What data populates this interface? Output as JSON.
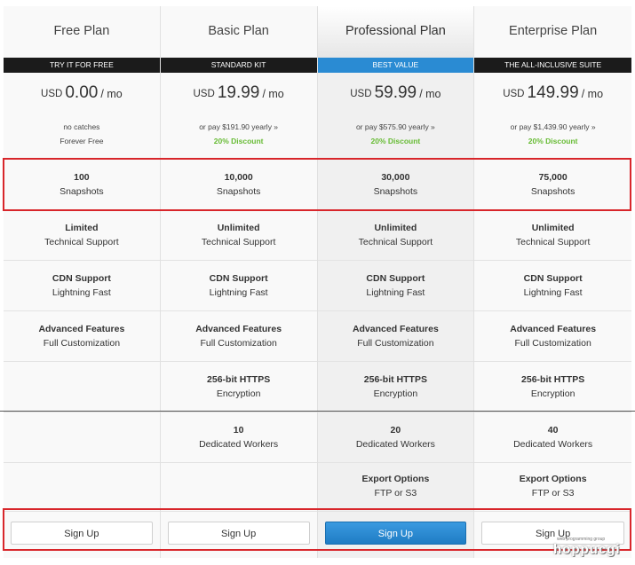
{
  "plans": [
    {
      "name": "Free Plan",
      "banner": "TRY IT FOR FREE",
      "currency": "USD",
      "price": "0.00",
      "per": "/ mo",
      "sub1": "no catches",
      "sub2": "Forever Free",
      "snapshots_value": "100",
      "snapshots_label": "Snapshots",
      "support_value": "Limited",
      "support_label": "Technical Support",
      "cdn_value": "CDN Support",
      "cdn_label": "Lightning Fast",
      "adv_value": "Advanced Features",
      "adv_label": "Full Customization",
      "https_value": "",
      "https_label": "",
      "workers_value": "",
      "workers_label": "",
      "export_value": "",
      "export_label": "",
      "button": "Sign Up"
    },
    {
      "name": "Basic Plan",
      "banner": "STANDARD KIT",
      "currency": "USD",
      "price": "19.99",
      "per": "/ mo",
      "sub1": "or pay $191.90 yearly »",
      "sub2": "20% Discount",
      "snapshots_value": "10,000",
      "snapshots_label": "Snapshots",
      "support_value": "Unlimited",
      "support_label": "Technical Support",
      "cdn_value": "CDN Support",
      "cdn_label": "Lightning Fast",
      "adv_value": "Advanced Features",
      "adv_label": "Full Customization",
      "https_value": "256-bit HTTPS",
      "https_label": "Encryption",
      "workers_value": "10",
      "workers_label": "Dedicated Workers",
      "export_value": "",
      "export_label": "",
      "button": "Sign Up"
    },
    {
      "name": "Professional Plan",
      "banner": "BEST VALUE",
      "currency": "USD",
      "price": "59.99",
      "per": "/ mo",
      "sub1": "or pay $575.90 yearly »",
      "sub2": "20% Discount",
      "snapshots_value": "30,000",
      "snapshots_label": "Snapshots",
      "support_value": "Unlimited",
      "support_label": "Technical Support",
      "cdn_value": "CDN Support",
      "cdn_label": "Lightning Fast",
      "adv_value": "Advanced Features",
      "adv_label": "Full Customization",
      "https_value": "256-bit HTTPS",
      "https_label": "Encryption",
      "workers_value": "20",
      "workers_label": "Dedicated Workers",
      "export_value": "Export Options",
      "export_label": "FTP or S3",
      "button": "Sign Up"
    },
    {
      "name": "Enterprise Plan",
      "banner": "THE ALL-INCLUSIVE SUITE",
      "currency": "USD",
      "price": "149.99",
      "per": "/ mo",
      "sub1": "or pay $1,439.90 yearly »",
      "sub2": "20% Discount",
      "snapshots_value": "75,000",
      "snapshots_label": "Snapshots",
      "support_value": "Unlimited",
      "support_label": "Technical Support",
      "cdn_value": "CDN Support",
      "cdn_label": "Lightning Fast",
      "adv_value": "Advanced Features",
      "adv_label": "Full Customization",
      "https_value": "256-bit HTTPS",
      "https_label": "Encryption",
      "workers_value": "40",
      "workers_label": "Dedicated Workers",
      "export_value": "Export Options",
      "export_label": "FTP or S3",
      "button": "Sign Up"
    }
  ],
  "watermark": {
    "text": "hoppucgi",
    "subtext": "web programming group"
  },
  "colors": {
    "accent": "#2a8bd3",
    "discount": "#66bb33",
    "highlight": "#d8262b",
    "banner": "#1b1b1b"
  }
}
